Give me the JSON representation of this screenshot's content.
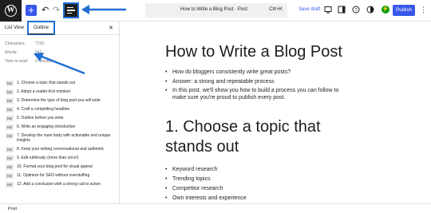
{
  "toolbar": {
    "wp_logo": "W",
    "add_label": "+",
    "undo_icon": "↶",
    "redo_icon": "↷",
    "doc_title": "How to Write a Blog Post · Post",
    "shortcut": "Ctrl+K",
    "save_draft": "Save draft",
    "publish": "Publish",
    "jetpack": "⚡"
  },
  "sidebar": {
    "tab_list_view": "List View",
    "tab_outline": "Outline",
    "close": "✕",
    "stats": [
      {
        "label": "Characters:",
        "value": "7720"
      },
      {
        "label": "Words:",
        "value": "541"
      },
      {
        "label": "Time to read:",
        "value": "2 minutes"
      }
    ],
    "outline": [
      {
        "level": "H2",
        "text": "1. Choose a topic that stands out"
      },
      {
        "level": "H2",
        "text": "2. Adopt a reader-first mindset"
      },
      {
        "level": "H2",
        "text": "3. Determine the type of blog post you will write"
      },
      {
        "level": "H2",
        "text": "4. Craft a compelling headline"
      },
      {
        "level": "H2",
        "text": "5. Outline before you write"
      },
      {
        "level": "H2",
        "text": "6. Write an engaging introduction"
      },
      {
        "level": "H2",
        "text": "7. Develop the main body with actionable and unique insights"
      },
      {
        "level": "H2",
        "text": "8. Keep your writing conversational and authentic"
      },
      {
        "level": "H2",
        "text": "9. Edit ruthlessly (more than once!)"
      },
      {
        "level": "H2",
        "text": "10. Format your blog post for visual appeal"
      },
      {
        "level": "H2",
        "text": "11. Optimize for SEO without overstuffing"
      },
      {
        "level": "H2",
        "text": "12. Add a conclusion with a strong call to action"
      }
    ]
  },
  "editor": {
    "title": "How to Write a Blog Post",
    "intro_list": [
      "How do bloggers consistently write great posts?",
      "Answer: a strong and repeatable process",
      "In this post, we'll show you how to build a process you can follow to make sure you're proud to publish every post."
    ],
    "heading1": "1. Choose a topic that stands out",
    "topic_list": [
      "Keyword research",
      "Trending topics",
      "Competitor research",
      "Own interests and experience"
    ]
  },
  "footer": {
    "breadcrumb": "Post"
  },
  "colors": {
    "accent": "#3858e9",
    "highlight": "#1e6ed6",
    "dark": "#1e1e1e"
  }
}
